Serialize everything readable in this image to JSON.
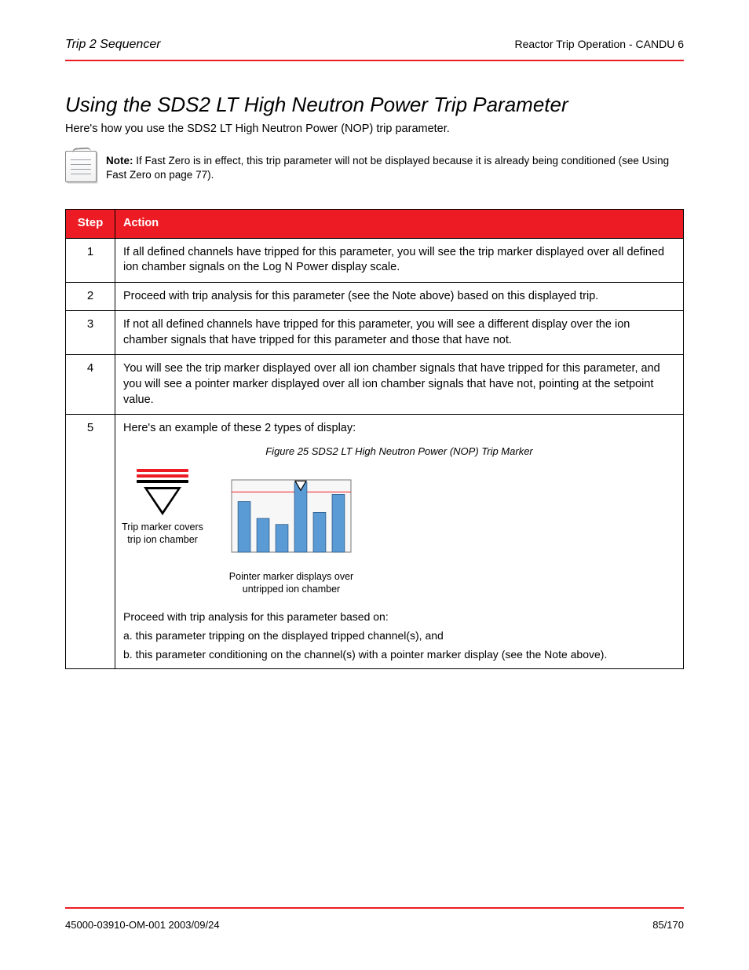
{
  "header": {
    "left_title": "Trip 2 Sequencer",
    "right_title": "Reactor Trip Operation - CANDU 6"
  },
  "section": {
    "title": "Using the SDS2 LT High Neutron Power Trip Parameter",
    "intro": "Here's how you use the SDS2 LT High Neutron Power (NOP) trip parameter.",
    "note_bold": "Note:",
    "note_text": "If Fast Zero is in effect, this trip parameter will not be displayed because it is already being conditioned (see Using Fast Zero on page 77)."
  },
  "table": {
    "headers": {
      "step": "Step",
      "action": "Action"
    },
    "rows": [
      {
        "step": "1",
        "action": "If all defined channels have tripped for this parameter, you will see the trip marker displayed over all defined ion chamber signals on the Log N Power display scale."
      },
      {
        "step": "2",
        "action": "Proceed with trip analysis for this parameter (see the Note above) based on this displayed trip."
      },
      {
        "step": "3",
        "action": "If not all defined channels have tripped for this parameter, you will see a different display over the ion chamber signals that have tripped for this parameter and those that have not."
      },
      {
        "step": "4",
        "action": "You will see the trip marker displayed over all ion chamber signals that have tripped for this parameter, and you will see a pointer marker displayed over all ion chamber signals that have not, pointing at the setpoint value."
      },
      {
        "step": "5",
        "action_intro": "Here's an example of these 2 types of display:",
        "figure_title": "Figure 25   SDS2 LT High Neutron Power (NOP) Trip Marker",
        "marker_caption": "Trip marker covers trip ion chamber",
        "chart_caption": "Pointer marker displays over untripped ion chamber",
        "tail_1": "Proceed with trip analysis for this parameter based on:",
        "tail_2": "a. this parameter tripping on the displayed tripped channel(s), and",
        "tail_3": "b. this parameter conditioning on the channel(s) with a pointer marker display (see the Note above).",
        "chart": {
          "setpoint": 50,
          "bars": [
            42,
            28,
            23,
            58,
            33,
            48
          ],
          "ymax": 60,
          "ymin": 0
        }
      }
    ]
  },
  "footer": {
    "left": "45000-03910-OM-001 2003/09/24",
    "right": "85/170"
  }
}
